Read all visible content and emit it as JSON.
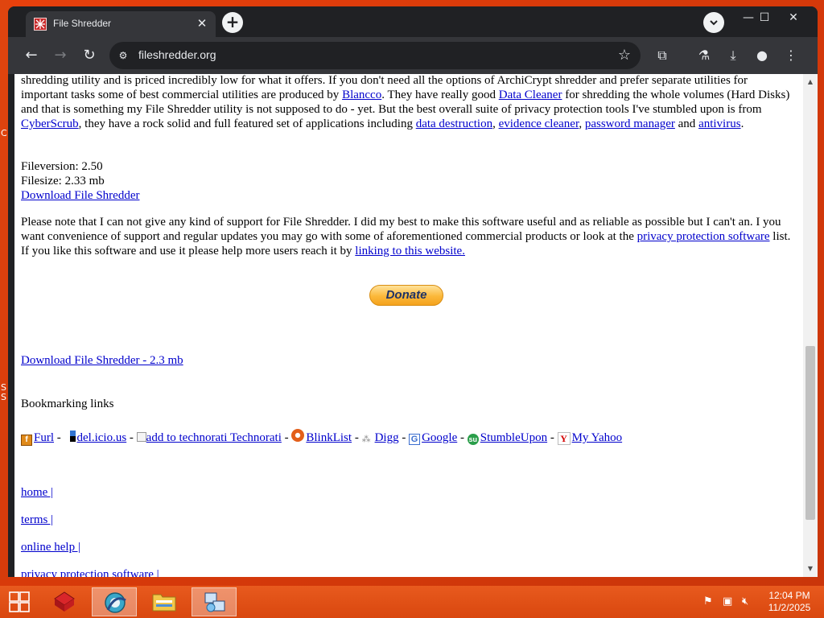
{
  "desktop": {
    "left_fragments": [
      "S",
      "S",
      "C"
    ]
  },
  "browser": {
    "tab": {
      "title": "File Shredder",
      "close_glyph": "✕"
    },
    "new_tab_glyph": "+",
    "tab_search_glyph": "⌄",
    "window_controls": {
      "minimize": "—",
      "maximize": "☐",
      "close": "✕"
    },
    "nav": {
      "back": "←",
      "forward": "→",
      "reload": "↻"
    },
    "omnibox": {
      "url": "fileshredder.org",
      "site_icon": "⚙",
      "bookmark_glyph": "☆"
    },
    "toolbar_icons": {
      "extensions": "⧉",
      "labs": "⚗",
      "downloads": "⤓",
      "profile": "●",
      "menu": "⋮"
    }
  },
  "page": {
    "para1": {
      "t1": "shredding utility and is priced incredibly low for what it offers. If you don't need all the options of ArchiCrypt shredder and prefer separate utilities for important tasks some of best commercial utilities are produced by ",
      "link_blancco": "Blancco",
      "t2": ". They have really good ",
      "link_datacleaner": "Data Cleaner",
      "t3": " for shredding the whole volumes (Hard Disks) and that is something my File Shredder utility is not supposed to do - yet. But the best overall suite of privacy protection tools I've stumbled upon is from ",
      "link_cyberscrub": "CyberScrub",
      "t4": ", they have a rock solid and full featured set of applications including ",
      "link_datadestruction": "data destruction",
      "t5": ", ",
      "link_evidence": "evidence cleaner",
      "t6": ", ",
      "link_password": "password manager",
      "t7": " and ",
      "link_antivirus": "antivirus",
      "t8": "."
    },
    "fileinfo": {
      "version": "Fileversion: 2.50",
      "size": "Filesize: 2.33 mb",
      "download_link": "Download File Shredder"
    },
    "para3": {
      "t1": "Please note that I can not give any kind of support for File Shredder. I did my best to make this software useful and as reliable as possible but I can't an. I you want convenience of support and regular updates you may go with some of aforementioned commercial products or look at the ",
      "link_privacy": "privacy protection software",
      "t2": " list. If you like this software and use it please help more users reach it by ",
      "link_linking": "linking to this website."
    },
    "donate_label": "Donate",
    "download_big": "Download File Shredder - 2.3 mb",
    "bookmarking_title": "Bookmarking links",
    "bookmarks": {
      "furl": "Furl",
      "delicious": "del.icio.us",
      "technorati": "add to technorati Technorati",
      "blinklist": "BlinkList",
      "digg": "Digg",
      "google": "Google",
      "stumbleupon": "StumbleUpon",
      "myyahoo": "My Yahoo",
      "sep": " - "
    },
    "footer": {
      "home": "home |",
      "terms": "terms |",
      "help": "online help |",
      "privacy": "privacy protection software |"
    }
  },
  "taskbar": {
    "clock_time": "12:04 PM",
    "clock_date": "11/2/2025"
  }
}
